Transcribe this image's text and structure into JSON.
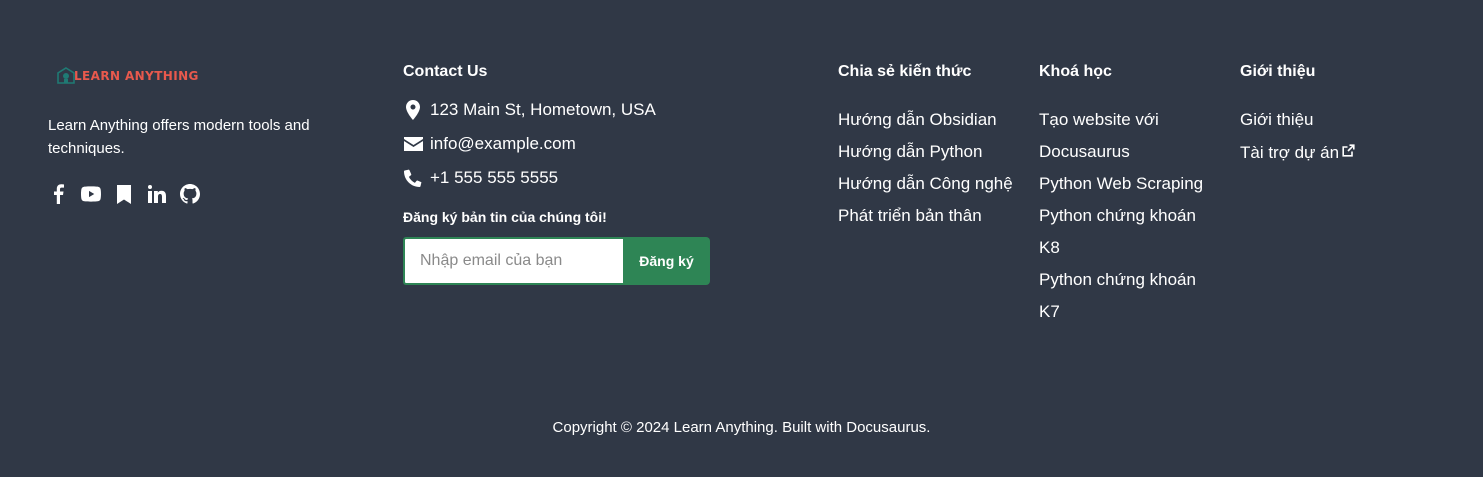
{
  "brand": {
    "logo_text": "LEARN ANYTHING",
    "tagline": "Learn Anything offers modern tools and techniques.",
    "socials": [
      "facebook-icon",
      "youtube-icon",
      "bookmark-icon",
      "linkedin-icon",
      "github-icon"
    ]
  },
  "contact": {
    "title": "Contact Us",
    "address": "123 Main St, Hometown, USA",
    "email": "info@example.com",
    "phone": "+1 555 555 5555",
    "newsletter_title": "Đăng ký bản tin của chúng tôi!",
    "newsletter_placeholder": "Nhập email của bạn",
    "newsletter_button": "Đăng ký"
  },
  "columns": [
    {
      "title": "Chia sẻ kiến thức",
      "items": [
        "Hướng dẫn Obsidian",
        "Hướng dẫn Python",
        "Hướng dẫn Công nghệ",
        "Phát triển bản thân"
      ]
    },
    {
      "title": "Khoá học",
      "items": [
        "Tạo website với Docusaurus",
        "Python Web Scraping",
        "Python chứng khoán K8",
        "Python chứng khoán K7"
      ]
    },
    {
      "title": "Giới thiệu",
      "items": [
        "Giới thiệu",
        "Tài trợ dự án"
      ]
    }
  ],
  "copyright": "Copyright © 2024 Learn Anything. Built with Docusaurus.",
  "colors": {
    "background": "#303846",
    "accent": "#2e8555",
    "logo": "#e8594d"
  }
}
